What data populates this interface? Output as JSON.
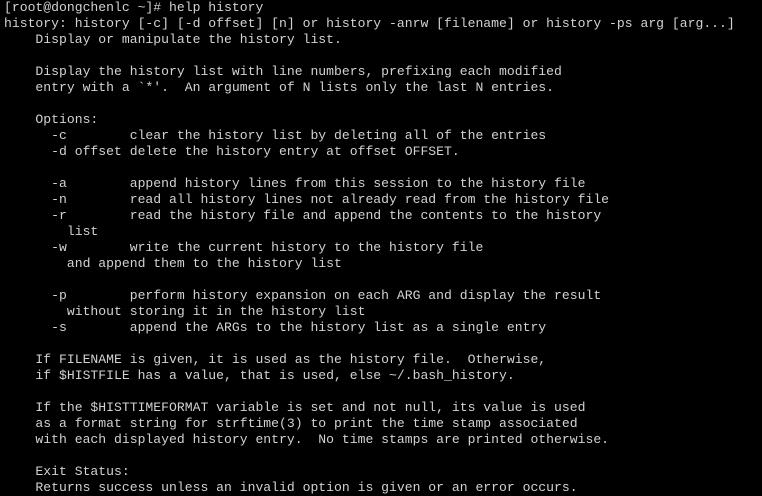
{
  "terminal": {
    "prompt": "[root@dongchenlc ~]# ",
    "command": "help history",
    "output_lines": [
      "history: history [-c] [-d offset] [n] or history -anrw [filename] or history -ps arg [arg...]",
      "    Display or manipulate the history list.",
      "",
      "    Display the history list with line numbers, prefixing each modified",
      "    entry with a `*'.  An argument of N lists only the last N entries.",
      "",
      "    Options:",
      "      -c        clear the history list by deleting all of the entries",
      "      -d offset delete the history entry at offset OFFSET.",
      "",
      "      -a        append history lines from this session to the history file",
      "      -n        read all history lines not already read from the history file",
      "      -r        read the history file and append the contents to the history",
      "        list",
      "      -w        write the current history to the history file",
      "        and append them to the history list",
      "",
      "      -p        perform history expansion on each ARG and display the result",
      "        without storing it in the history list",
      "      -s        append the ARGs to the history list as a single entry",
      "",
      "    If FILENAME is given, it is used as the history file.  Otherwise,",
      "    if $HISTFILE has a value, that is used, else ~/.bash_history.",
      "",
      "    If the $HISTTIMEFORMAT variable is set and not null, its value is used",
      "    as a format string for strftime(3) to print the time stamp associated",
      "    with each displayed history entry.  No time stamps are printed otherwise.",
      "",
      "    Exit Status:",
      "    Returns success unless an invalid option is given or an error occurs."
    ]
  },
  "colors": {
    "background": "#000000",
    "foreground": "#d2d2d2"
  }
}
